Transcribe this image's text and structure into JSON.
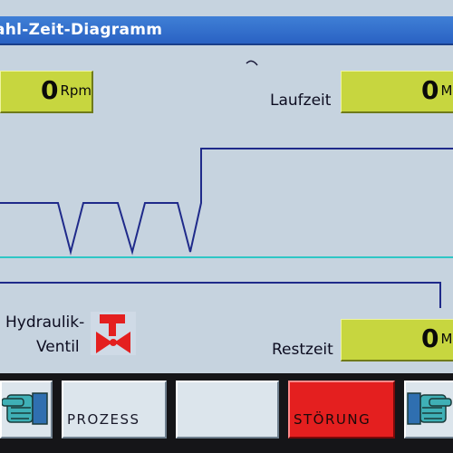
{
  "window": {
    "title": "ahl-Zeit-Diagramm"
  },
  "speed": {
    "value": "0",
    "unit": "Rpm"
  },
  "runtime": {
    "label": "Laufzeit",
    "value": "0",
    "unit": "M"
  },
  "remaining": {
    "label": "Restzeit",
    "value": "0",
    "unit": "M"
  },
  "valve": {
    "label_line1": "Hydraulik-",
    "label_line2": "Ventil",
    "icon": "hydraulic-valve-icon",
    "state_color": "#e41f1f"
  },
  "buttons": {
    "left_hand": {
      "icon": "hand-pointing-left-icon"
    },
    "prozess": "PROZESS",
    "blank": "",
    "stoerung": "STÖRUNG",
    "right_hand": {
      "icon": "hand-pointing-right-icon"
    }
  },
  "colors": {
    "accent": "#2a62c3",
    "field": "#c7d63f",
    "fault": "#e41f1f",
    "trace": "#1f2a8a",
    "baseline": "#2ec6c6"
  }
}
